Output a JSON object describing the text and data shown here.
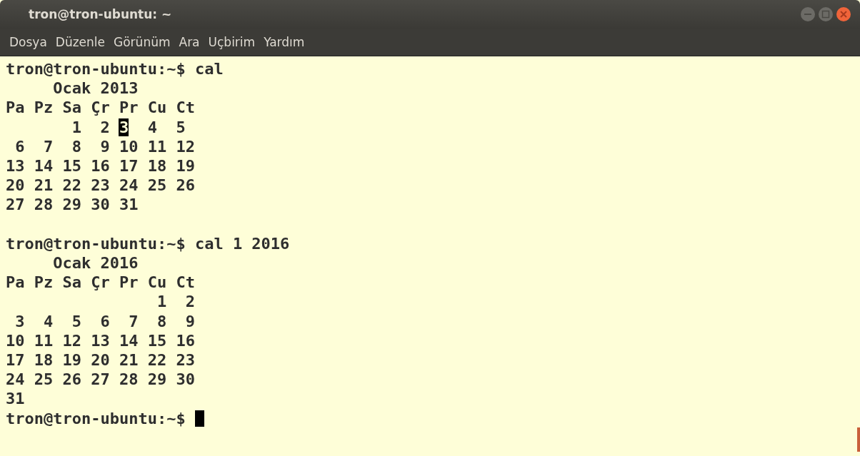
{
  "window": {
    "title": "tron@tron-ubuntu: ~"
  },
  "menu": [
    {
      "label": "Dosya"
    },
    {
      "label": "Düzenle"
    },
    {
      "label": "Görünüm"
    },
    {
      "label": "Ara"
    },
    {
      "label": "Uçbirim"
    },
    {
      "label": "Yardım"
    }
  ],
  "terminal": {
    "lines": [
      {
        "text": "tron@tron-ubuntu:~$ cal"
      },
      {
        "text": "     Ocak 2013"
      },
      {
        "text": "Pa Pz Sa Çr Pr Cu Ct"
      },
      {
        "segments": [
          {
            "text": "       1  2",
            "highlighted": false
          },
          {
            "text": " 3",
            "highlighted": true
          },
          {
            "text": "  4  5",
            "highlighted": false
          }
        ]
      },
      {
        "text": " 6  7  8  9 10 11 12"
      },
      {
        "text": "13 14 15 16 17 18 19"
      },
      {
        "text": "20 21 22 23 24 25 26"
      },
      {
        "text": "27 28 29 30 31"
      },
      {
        "kind": "blank"
      },
      {
        "text": "tron@tron-ubuntu:~$ cal 1 2016"
      },
      {
        "text": "     Ocak 2016"
      },
      {
        "text": "Pa Pz Sa Çr Pr Cu Ct"
      },
      {
        "text": "                1  2"
      },
      {
        "text": " 3  4  5  6  7  8  9"
      },
      {
        "text": "10 11 12 13 14 15 16"
      },
      {
        "text": "17 18 19 20 21 22 23"
      },
      {
        "text": "24 25 26 27 28 29 30"
      },
      {
        "text": "31"
      },
      {
        "text": "tron@tron-ubuntu:~$ ",
        "cursor": true
      }
    ]
  }
}
